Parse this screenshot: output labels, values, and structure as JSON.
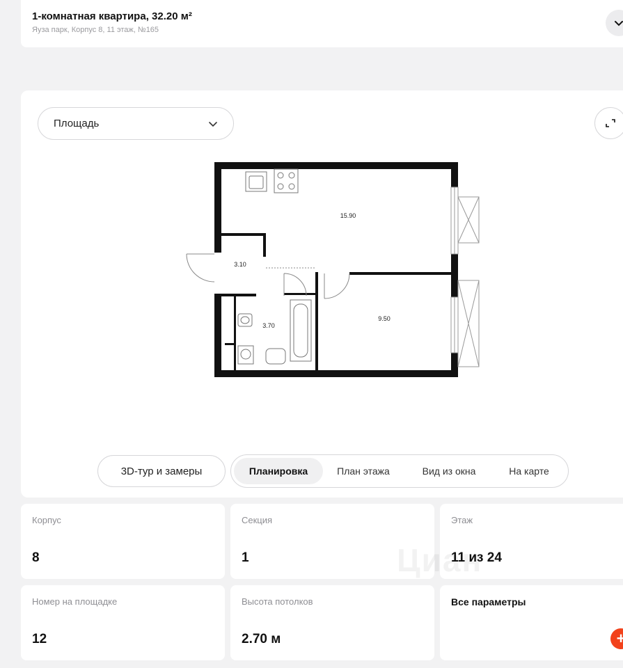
{
  "header": {
    "title": "1-комнатная квартира, 32.20 м²",
    "subtitle": "Яуза парк, Корпус 8, 11 этаж, №165"
  },
  "plan": {
    "select_label": "Площадь",
    "rooms": [
      {
        "name": "kitchen-living",
        "area": "15.90"
      },
      {
        "name": "hallway",
        "area": "3.10"
      },
      {
        "name": "bathroom",
        "area": "3.70"
      },
      {
        "name": "bedroom",
        "area": "9.50"
      }
    ]
  },
  "actions": {
    "tour_label": "3D-тур и замеры",
    "tabs": [
      {
        "label": "Планировка",
        "active": true
      },
      {
        "label": "План этажа",
        "active": false
      },
      {
        "label": "Вид из окна",
        "active": false
      },
      {
        "label": "На карте",
        "active": false
      }
    ]
  },
  "params": [
    {
      "label": "Корпус",
      "value": "8"
    },
    {
      "label": "Секция",
      "value": "1"
    },
    {
      "label": "Этаж",
      "value": "11 из 24"
    },
    {
      "label": "Номер на площадке",
      "value": "12"
    },
    {
      "label": "Высота потолков",
      "value": "2.70 м"
    }
  ],
  "all_params_label": "Все параметры",
  "watermark": "Циан",
  "colors": {
    "accent": "#f2421b",
    "background": "#f2f2f3"
  }
}
